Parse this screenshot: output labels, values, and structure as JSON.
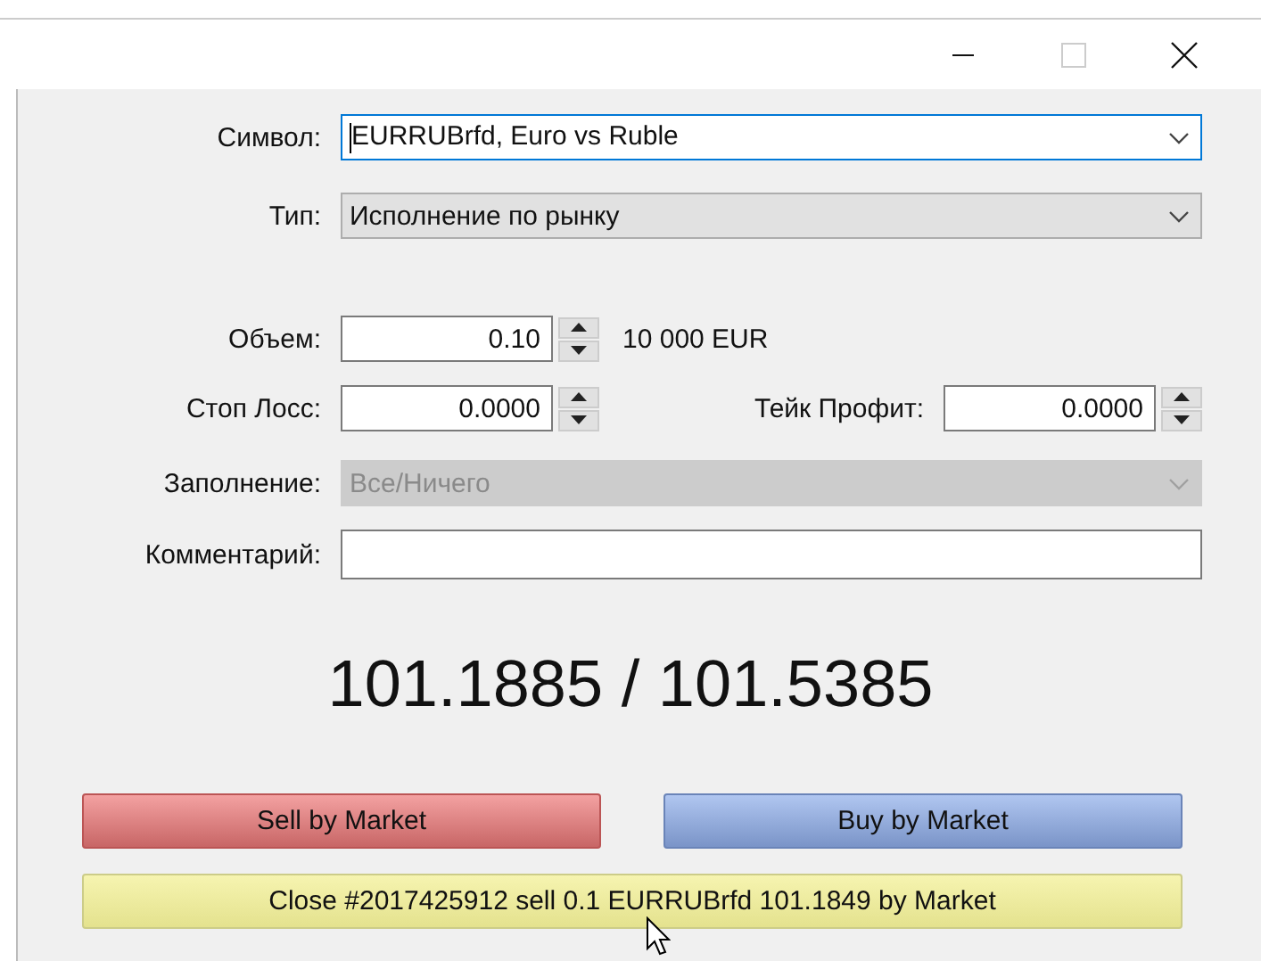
{
  "symbol": {
    "label": "Символ:",
    "value": "EURRUBrfd, Euro vs Ruble",
    "focused": true
  },
  "type": {
    "label": "Тип:",
    "value": "Исполнение по рынку"
  },
  "volume": {
    "label": "Объем:",
    "value": "0.10",
    "note": "10 000 EUR"
  },
  "stop_loss": {
    "label": "Стоп Лосс:",
    "value": "0.0000"
  },
  "take_profit": {
    "label": "Тейк Профит:",
    "value": "0.0000"
  },
  "filling": {
    "label": "Заполнение:",
    "value": "Все/Ничего",
    "disabled": true
  },
  "comment": {
    "label": "Комментарий:"
  },
  "price": "101.1885 / 101.5385",
  "buttons": [
    {
      "label": "Sell by Market",
      "kind": "sell"
    },
    {
      "label": "Buy by Market",
      "kind": "buy"
    },
    {
      "label": "Close #2017425912 sell 0.1 EURRUBrfd 101.1849 by Market",
      "kind": "close"
    }
  ]
}
